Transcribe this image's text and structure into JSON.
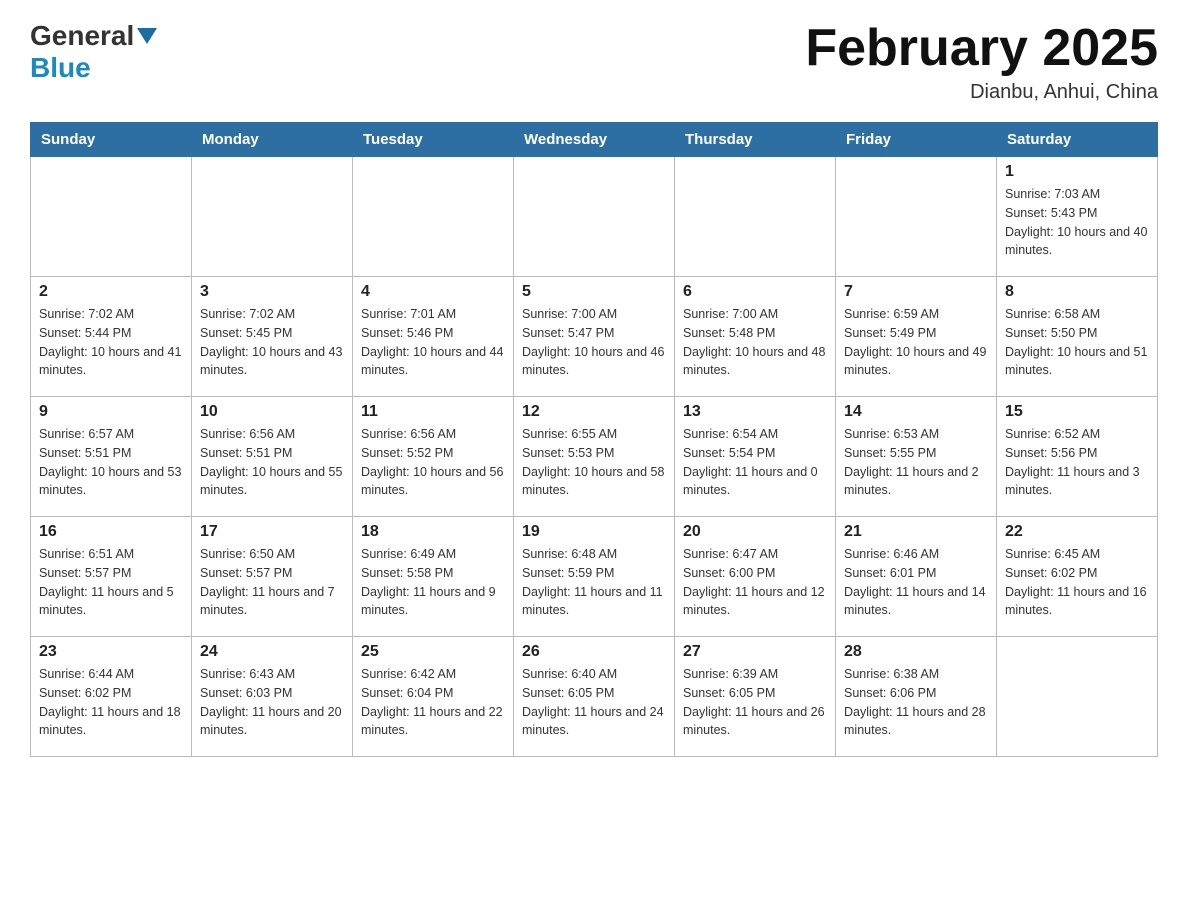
{
  "header": {
    "logo_general": "General",
    "logo_blue": "Blue",
    "month_title": "February 2025",
    "location": "Dianbu, Anhui, China"
  },
  "weekdays": [
    "Sunday",
    "Monday",
    "Tuesday",
    "Wednesday",
    "Thursday",
    "Friday",
    "Saturday"
  ],
  "weeks": [
    [
      {
        "day": "",
        "info": ""
      },
      {
        "day": "",
        "info": ""
      },
      {
        "day": "",
        "info": ""
      },
      {
        "day": "",
        "info": ""
      },
      {
        "day": "",
        "info": ""
      },
      {
        "day": "",
        "info": ""
      },
      {
        "day": "1",
        "info": "Sunrise: 7:03 AM\nSunset: 5:43 PM\nDaylight: 10 hours and 40 minutes."
      }
    ],
    [
      {
        "day": "2",
        "info": "Sunrise: 7:02 AM\nSunset: 5:44 PM\nDaylight: 10 hours and 41 minutes."
      },
      {
        "day": "3",
        "info": "Sunrise: 7:02 AM\nSunset: 5:45 PM\nDaylight: 10 hours and 43 minutes."
      },
      {
        "day": "4",
        "info": "Sunrise: 7:01 AM\nSunset: 5:46 PM\nDaylight: 10 hours and 44 minutes."
      },
      {
        "day": "5",
        "info": "Sunrise: 7:00 AM\nSunset: 5:47 PM\nDaylight: 10 hours and 46 minutes."
      },
      {
        "day": "6",
        "info": "Sunrise: 7:00 AM\nSunset: 5:48 PM\nDaylight: 10 hours and 48 minutes."
      },
      {
        "day": "7",
        "info": "Sunrise: 6:59 AM\nSunset: 5:49 PM\nDaylight: 10 hours and 49 minutes."
      },
      {
        "day": "8",
        "info": "Sunrise: 6:58 AM\nSunset: 5:50 PM\nDaylight: 10 hours and 51 minutes."
      }
    ],
    [
      {
        "day": "9",
        "info": "Sunrise: 6:57 AM\nSunset: 5:51 PM\nDaylight: 10 hours and 53 minutes."
      },
      {
        "day": "10",
        "info": "Sunrise: 6:56 AM\nSunset: 5:51 PM\nDaylight: 10 hours and 55 minutes."
      },
      {
        "day": "11",
        "info": "Sunrise: 6:56 AM\nSunset: 5:52 PM\nDaylight: 10 hours and 56 minutes."
      },
      {
        "day": "12",
        "info": "Sunrise: 6:55 AM\nSunset: 5:53 PM\nDaylight: 10 hours and 58 minutes."
      },
      {
        "day": "13",
        "info": "Sunrise: 6:54 AM\nSunset: 5:54 PM\nDaylight: 11 hours and 0 minutes."
      },
      {
        "day": "14",
        "info": "Sunrise: 6:53 AM\nSunset: 5:55 PM\nDaylight: 11 hours and 2 minutes."
      },
      {
        "day": "15",
        "info": "Sunrise: 6:52 AM\nSunset: 5:56 PM\nDaylight: 11 hours and 3 minutes."
      }
    ],
    [
      {
        "day": "16",
        "info": "Sunrise: 6:51 AM\nSunset: 5:57 PM\nDaylight: 11 hours and 5 minutes."
      },
      {
        "day": "17",
        "info": "Sunrise: 6:50 AM\nSunset: 5:57 PM\nDaylight: 11 hours and 7 minutes."
      },
      {
        "day": "18",
        "info": "Sunrise: 6:49 AM\nSunset: 5:58 PM\nDaylight: 11 hours and 9 minutes."
      },
      {
        "day": "19",
        "info": "Sunrise: 6:48 AM\nSunset: 5:59 PM\nDaylight: 11 hours and 11 minutes."
      },
      {
        "day": "20",
        "info": "Sunrise: 6:47 AM\nSunset: 6:00 PM\nDaylight: 11 hours and 12 minutes."
      },
      {
        "day": "21",
        "info": "Sunrise: 6:46 AM\nSunset: 6:01 PM\nDaylight: 11 hours and 14 minutes."
      },
      {
        "day": "22",
        "info": "Sunrise: 6:45 AM\nSunset: 6:02 PM\nDaylight: 11 hours and 16 minutes."
      }
    ],
    [
      {
        "day": "23",
        "info": "Sunrise: 6:44 AM\nSunset: 6:02 PM\nDaylight: 11 hours and 18 minutes."
      },
      {
        "day": "24",
        "info": "Sunrise: 6:43 AM\nSunset: 6:03 PM\nDaylight: 11 hours and 20 minutes."
      },
      {
        "day": "25",
        "info": "Sunrise: 6:42 AM\nSunset: 6:04 PM\nDaylight: 11 hours and 22 minutes."
      },
      {
        "day": "26",
        "info": "Sunrise: 6:40 AM\nSunset: 6:05 PM\nDaylight: 11 hours and 24 minutes."
      },
      {
        "day": "27",
        "info": "Sunrise: 6:39 AM\nSunset: 6:05 PM\nDaylight: 11 hours and 26 minutes."
      },
      {
        "day": "28",
        "info": "Sunrise: 6:38 AM\nSunset: 6:06 PM\nDaylight: 11 hours and 28 minutes."
      },
      {
        "day": "",
        "info": ""
      }
    ]
  ]
}
